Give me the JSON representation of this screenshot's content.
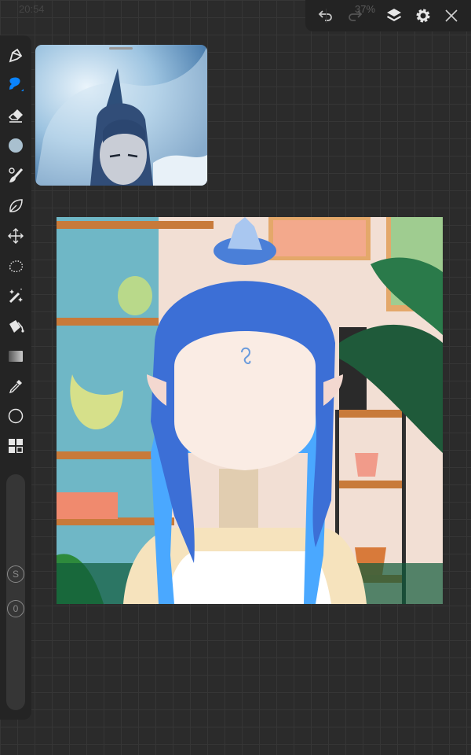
{
  "status_bar": {
    "time": "20:54",
    "battery": "37%"
  },
  "top_toolbar": {
    "undo": "undo-icon",
    "redo": "redo-icon",
    "layers": "layers-icon",
    "settings": "gear-icon",
    "close": "close-icon"
  },
  "sidebar": {
    "tools": [
      "pencil",
      "brush",
      "eraser",
      "color",
      "smudge",
      "lasso-leaf",
      "transform",
      "selection",
      "magic-wand",
      "fill",
      "gradient",
      "eyedropper",
      "shape",
      "more"
    ],
    "active_tool": "brush",
    "active_color": "#0a84ff",
    "current_color": "#a9c0cf",
    "size_button": "S",
    "opacity_button": "0"
  },
  "colors": {
    "accent": "#0a84ff",
    "hair": "#3c6fd6",
    "skin": "#faece4"
  }
}
